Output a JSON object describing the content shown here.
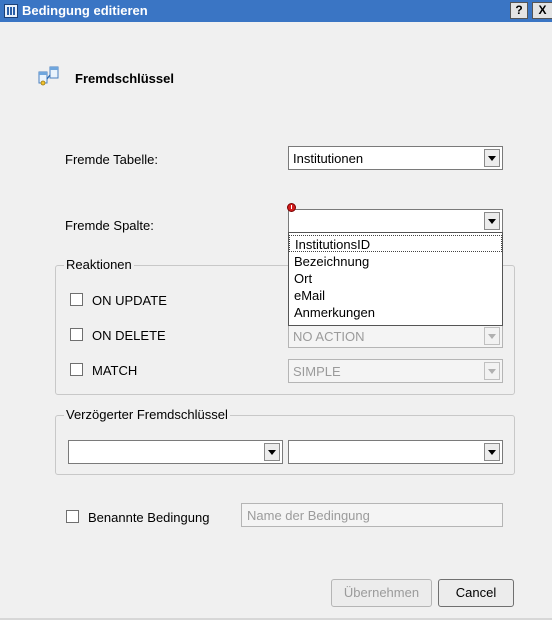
{
  "window": {
    "title": "Bedingung editieren",
    "help_label": "?",
    "close_label": "X"
  },
  "header": {
    "title": "Fremdschlüssel",
    "icon": "foreign-key-icon"
  },
  "fields": {
    "foreign_table_label": "Fremde Tabelle:",
    "foreign_table_value": "Institutionen",
    "foreign_column_label": "Fremde Spalte:",
    "foreign_column_value": ""
  },
  "dropdown": {
    "items": [
      "InstitutionsID",
      "Bezeichnung",
      "Ort",
      "eMail",
      "Anmerkungen"
    ],
    "focused": "InstitutionsID"
  },
  "reactions": {
    "title": "Reaktionen",
    "on_update_label": "ON UPDATE",
    "on_delete_label": "ON DELETE",
    "on_delete_value": "NO ACTION",
    "match_label": "MATCH",
    "match_value": "SIMPLE"
  },
  "deferred": {
    "title": "Verzögerter Fremdschlüssel",
    "first_value": "",
    "second_value": ""
  },
  "named": {
    "checkbox_label": "Benannte Bedingung",
    "placeholder": "Name der Bedingung"
  },
  "buttons": {
    "apply": "Übernehmen",
    "cancel": "Cancel"
  }
}
